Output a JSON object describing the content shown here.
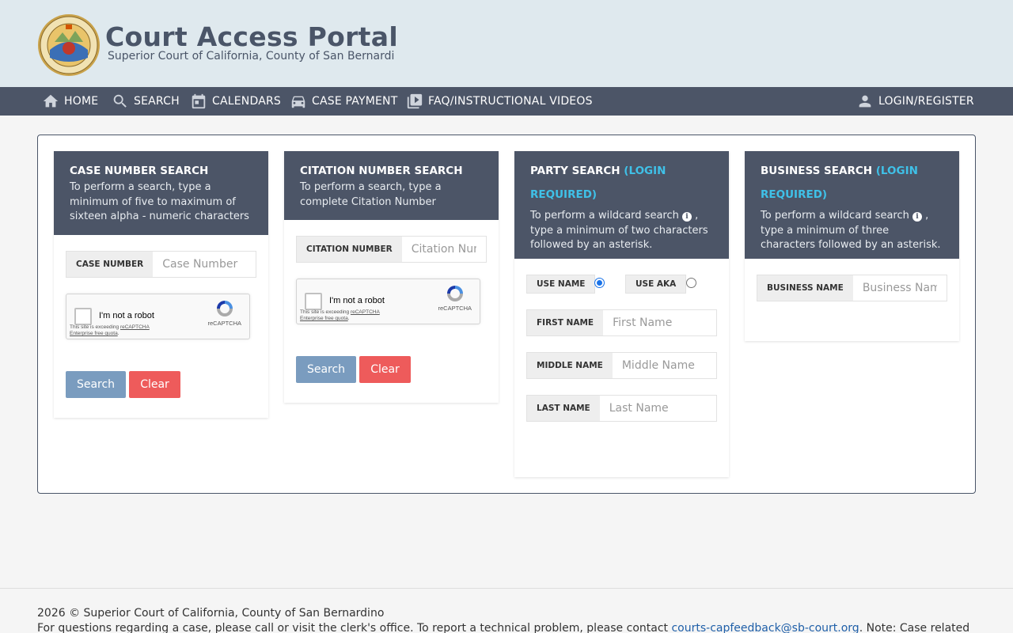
{
  "header": {
    "title": "Court Access Portal",
    "subtitle": "Superior Court of California, County of San Bernardi"
  },
  "nav": {
    "home": "HOME",
    "search": "SEARCH",
    "calendars": "CALENDARS",
    "case_payment": "CASE PAYMENT",
    "faq": "FAQ/INSTRUCTIONAL VIDEOS",
    "login": "LOGIN/REGISTER"
  },
  "case_search": {
    "title": "CASE NUMBER SEARCH",
    "desc": "To perform a search, type a minimum of five to maximum of sixteen alpha - numeric characters",
    "field_label": "CASE NUMBER",
    "placeholder": "Case Number",
    "search_label": "Search",
    "clear_label": "Clear"
  },
  "citation_search": {
    "title": "CITATION NUMBER SEARCH",
    "desc": "To perform a search, type a complete Citation Number",
    "field_label": "CITATION NUMBER",
    "placeholder": "Citation Number",
    "search_label": "Search",
    "clear_label": "Clear"
  },
  "party_search": {
    "title": "PARTY SEARCH",
    "required": "(LOGIN REQUIRED)",
    "desc_a": "To perform a wildcard search",
    "desc_b": ", type a minimum of two characters followed by an asterisk.",
    "use_name": "USE NAME",
    "use_aka": "USE AKA",
    "first_label": "FIRST NAME",
    "first_placeholder": "First Name",
    "middle_label": "MIDDLE NAME",
    "middle_placeholder": "Middle Name",
    "last_label": "LAST NAME",
    "last_placeholder": "Last Name"
  },
  "business_search": {
    "title": "BUSINESS SEARCH",
    "required": "(LOGIN REQUIRED)",
    "desc_a": "To perform a wildcard search",
    "desc_b": ", type a minimum of three characters followed by an asterisk.",
    "field_label": "BUSINESS NAME",
    "placeholder": "Business Name"
  },
  "captcha": {
    "label": "I'm not a robot",
    "brand": "reCAPTCHA",
    "quota_a": "This site is exceeding ",
    "quota_link": "reCAPTCHA Enterprise free quota",
    "quota_b": "."
  },
  "footer": {
    "copyright": "2026 © Superior Court of California, County of San Bernardino",
    "note_a": "For questions regarding a case, please call or visit the clerk's office. To report a technical problem, please contact ",
    "email": "courts-capfeedback@sb-court.org",
    "note_b": ". Note: Case related"
  },
  "colors": {
    "nav_bg": "#4c5567",
    "header_bg": "#dfe9ee",
    "accent_required": "#3fc1e8",
    "search_btn": "#7a9cbf",
    "clear_btn": "#ee5b5b"
  }
}
